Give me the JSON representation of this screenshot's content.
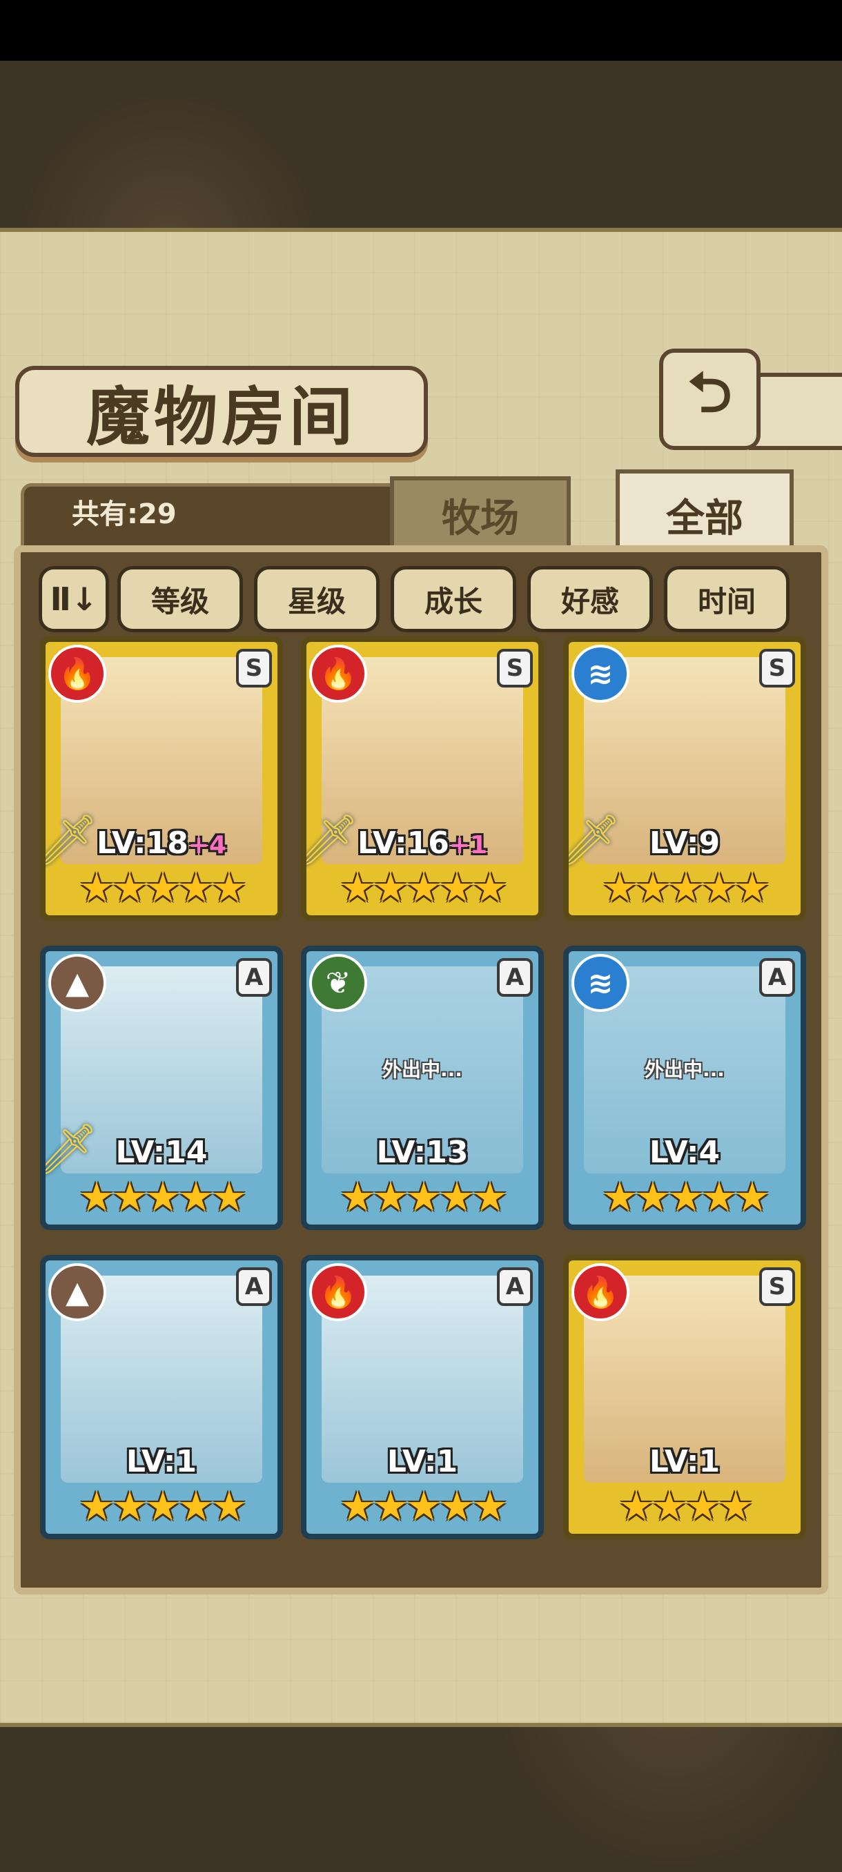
{
  "header": {
    "title": "魔物房间",
    "back_icon": "back-arrow-icon"
  },
  "summary": {
    "count_text": "共有:29"
  },
  "tabs": [
    {
      "label": "牧场",
      "selected": false
    },
    {
      "label": "全部",
      "selected": true
    }
  ],
  "sort_bar": {
    "toggle_glyph": "Ⅱ↓",
    "filters": [
      "等级",
      "星级",
      "成长",
      "好感",
      "时间"
    ]
  },
  "colors": {
    "fire": "#d3242a",
    "water": "#2b7fd0",
    "earth": "#7a5a44",
    "grass": "#3e7a34",
    "gold_frame": "#e7c12c",
    "blue_frame": "#6fb2cf"
  },
  "cards": [
    {
      "element": "fire",
      "element_glyph": "🔥",
      "rank": "S",
      "frame": "gold",
      "level": "LV:18",
      "bonus": "+4",
      "weapon": true,
      "stars": 5,
      "status": ""
    },
    {
      "element": "fire",
      "element_glyph": "🔥",
      "rank": "S",
      "frame": "gold",
      "level": "LV:16",
      "bonus": "+1",
      "weapon": true,
      "stars": 5,
      "status": ""
    },
    {
      "element": "water",
      "element_glyph": "≋",
      "rank": "S",
      "frame": "gold",
      "level": "LV:9",
      "bonus": "",
      "weapon": true,
      "stars": 5,
      "status": ""
    },
    {
      "element": "earth",
      "element_glyph": "▲",
      "rank": "A",
      "frame": "blue",
      "level": "LV:14",
      "bonus": "",
      "weapon": true,
      "stars": 5,
      "status": ""
    },
    {
      "element": "grass",
      "element_glyph": "❦",
      "rank": "A",
      "frame": "blue",
      "level": "LV:13",
      "bonus": "",
      "weapon": false,
      "stars": 5,
      "status": "外出中..."
    },
    {
      "element": "water",
      "element_glyph": "≋",
      "rank": "A",
      "frame": "blue",
      "level": "LV:4",
      "bonus": "",
      "weapon": false,
      "stars": 5,
      "status": "外出中..."
    },
    {
      "element": "earth",
      "element_glyph": "▲",
      "rank": "A",
      "frame": "blue",
      "level": "LV:1",
      "bonus": "",
      "weapon": false,
      "stars": 5,
      "status": ""
    },
    {
      "element": "fire",
      "element_glyph": "🔥",
      "rank": "A",
      "frame": "blue",
      "level": "LV:1",
      "bonus": "",
      "weapon": false,
      "stars": 5,
      "status": ""
    },
    {
      "element": "fire",
      "element_glyph": "🔥",
      "rank": "S",
      "frame": "gold",
      "level": "LV:1",
      "bonus": "",
      "weapon": false,
      "stars": 4,
      "status": ""
    }
  ]
}
